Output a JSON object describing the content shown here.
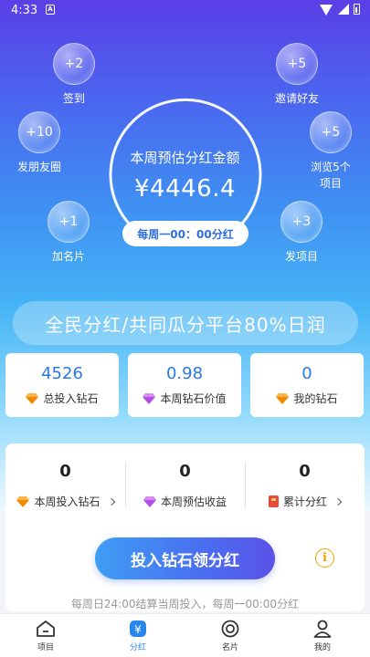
{
  "status": {
    "time": "4:33",
    "notif": "A"
  },
  "bubbles": [
    {
      "value": "+2",
      "label": "签到",
      "icon": "check-in-bubble"
    },
    {
      "value": "+5",
      "label": "邀请好友",
      "icon": "invite-bubble"
    },
    {
      "value": "+10",
      "label": "发朋友圈",
      "icon": "moments-bubble"
    },
    {
      "value": "+5",
      "label": "浏览5个\n项目",
      "icon": "browse-bubble"
    },
    {
      "value": "+1",
      "label": "加名片",
      "icon": "card-bubble"
    },
    {
      "value": "+3",
      "label": "发项目",
      "icon": "project-bubble"
    }
  ],
  "center": {
    "title": "本周预估分红金额",
    "amount": "¥4446.4",
    "schedule": "每周一00：00分红"
  },
  "slogan": "全民分红/共同瓜分平台80%日润",
  "stats": [
    {
      "value": "4526",
      "label": "总投入钻石",
      "gem_color": "#f08a00"
    },
    {
      "value": "0.98",
      "label": "本周钻石价值",
      "gem_color": "#b34ee6"
    },
    {
      "value": "0",
      "label": "我的钻石",
      "gem_color": "#f08a00"
    }
  ],
  "summary": [
    {
      "value": "0",
      "label": "本周投入钻石",
      "icon": "gem-icon",
      "gem_color": "#f08a00"
    },
    {
      "value": "0",
      "label": "本周预估收益",
      "icon": "gem-icon",
      "gem_color": "#b34ee6"
    },
    {
      "value": "0",
      "label": "累计分红",
      "icon": "red-envelope-icon"
    }
  ],
  "cta": {
    "label": "投入钻石领分红"
  },
  "note": "每周日24:00结算当周投入，每周一00:00分红",
  "tabs": [
    {
      "label": "项目",
      "icon": "home-icon",
      "active": false
    },
    {
      "label": "分红",
      "icon": "dividend-icon",
      "active": true
    },
    {
      "label": "名片",
      "icon": "card-icon",
      "active": false
    },
    {
      "label": "我的",
      "icon": "profile-icon",
      "active": false
    }
  ],
  "colors": {
    "accent": "#2a86e8",
    "cta_start": "#3f9df4",
    "cta_end": "#5a52e8",
    "info": "#f2a200"
  }
}
